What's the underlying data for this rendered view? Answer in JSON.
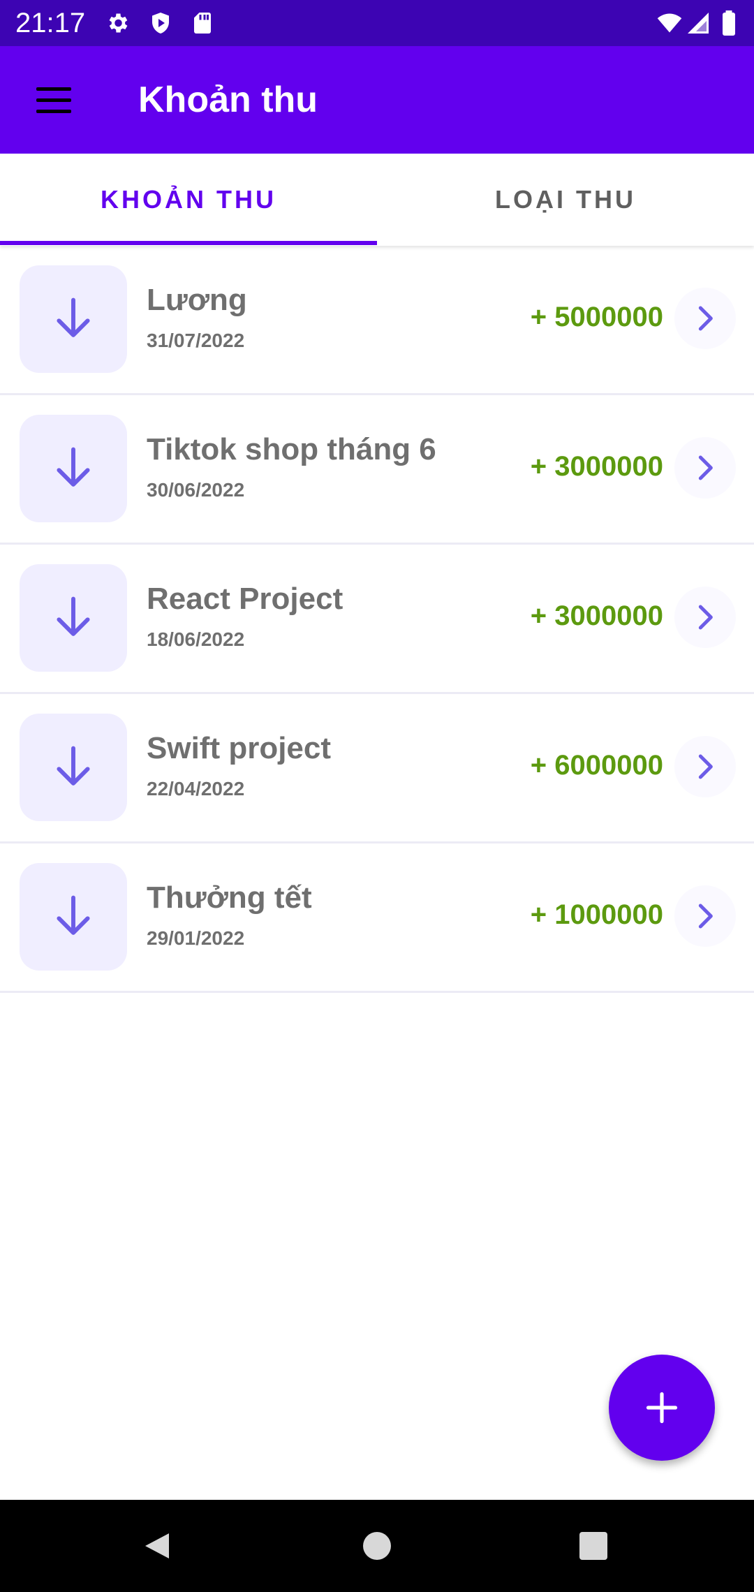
{
  "status_bar": {
    "time": "21:17",
    "icons": [
      "settings-icon",
      "shield-icon",
      "sd-card-icon",
      "wifi-icon",
      "signal-icon",
      "battery-icon"
    ]
  },
  "app_bar": {
    "title": "Khoản thu",
    "menu_icon": "menu-icon"
  },
  "tabs": [
    {
      "label": "KHOẢN THU",
      "active": true
    },
    {
      "label": "LOẠI THU",
      "active": false
    }
  ],
  "incomes": [
    {
      "title": "Lương",
      "date": "31/07/2022",
      "amount": "+ 5000000"
    },
    {
      "title": "Tiktok shop tháng 6",
      "date": "30/06/2022",
      "amount": "+ 3000000"
    },
    {
      "title": "React Project",
      "date": "18/06/2022",
      "amount": "+ 3000000"
    },
    {
      "title": "Swift project",
      "date": "22/04/2022",
      "amount": "+ 6000000"
    },
    {
      "title": "Thưởng tết",
      "date": "29/01/2022",
      "amount": "+ 1000000"
    }
  ],
  "fab": {
    "icon": "plus-icon"
  },
  "nav_bar": {
    "icons": [
      "back-icon",
      "home-icon",
      "recents-icon"
    ]
  },
  "colors": {
    "primary": "#6200ee",
    "status_bar": "#3d04b3",
    "amount_green": "#5c9a0f",
    "icon_box_bg": "#f0eeff",
    "icon_purple": "#6c5ce7"
  }
}
